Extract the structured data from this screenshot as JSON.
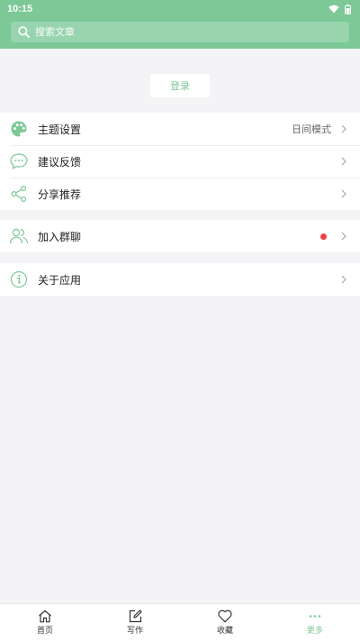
{
  "status": {
    "time": "10:15"
  },
  "search": {
    "placeholder": "搜索文章"
  },
  "login": {
    "label": "登录"
  },
  "settings_group": [
    {
      "label": "主题设置",
      "value": "日间模式",
      "icon": "palette-icon"
    },
    {
      "label": "建议反馈",
      "icon": "chat-bubble-icon"
    },
    {
      "label": "分享推荐",
      "icon": "share-icon"
    }
  ],
  "group_chat": {
    "label": "加入群聊",
    "icon": "users-icon",
    "badge_color": "#ef4141"
  },
  "about": {
    "label": "关于应用",
    "icon": "info-icon"
  },
  "tabs": [
    {
      "label": "首页",
      "icon": "home-icon"
    },
    {
      "label": "写作",
      "icon": "edit-icon"
    },
    {
      "label": "收藏",
      "icon": "heart-icon"
    },
    {
      "label": "更多",
      "icon": "more-icon",
      "active": true
    }
  ],
  "colors": {
    "accent": "#7cc896",
    "background": "#f4f4f6",
    "badge": "#ef4141"
  }
}
